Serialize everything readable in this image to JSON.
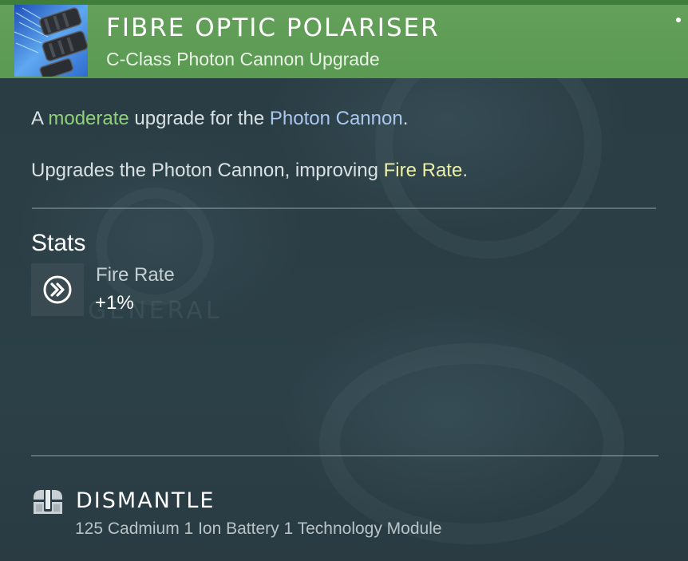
{
  "header": {
    "title": "FIBRE OPTIC POLARISER",
    "subtitle": "C-Class Photon Cannon Upgrade",
    "item_icon": "photon-cannon-upgrade-icon",
    "accent_color": "#5a9a52"
  },
  "description": {
    "line1": {
      "prefix": "A ",
      "quality": "moderate",
      "middle": " upgrade for the ",
      "target": "Photon Cannon",
      "suffix": "."
    },
    "line2": {
      "prefix": "Upgrades the Photon Cannon, improving ",
      "stat": "Fire Rate",
      "suffix": "."
    }
  },
  "stats": {
    "heading": "Stats",
    "items": [
      {
        "icon": "double-chevron-right-icon",
        "name": "Fire Rate",
        "value": "+1%"
      }
    ]
  },
  "dismantle": {
    "icon": "dismantle-icon",
    "label": "DISMANTLE",
    "resources": "125 Cadmium 1 Ion Battery 1 Technology Module"
  },
  "background": {
    "watermark": "GENERAL"
  },
  "colors": {
    "quality_green": "#8fd07a",
    "link_blue": "#a9c7ee",
    "stat_yellow": "#ecf0a6"
  }
}
